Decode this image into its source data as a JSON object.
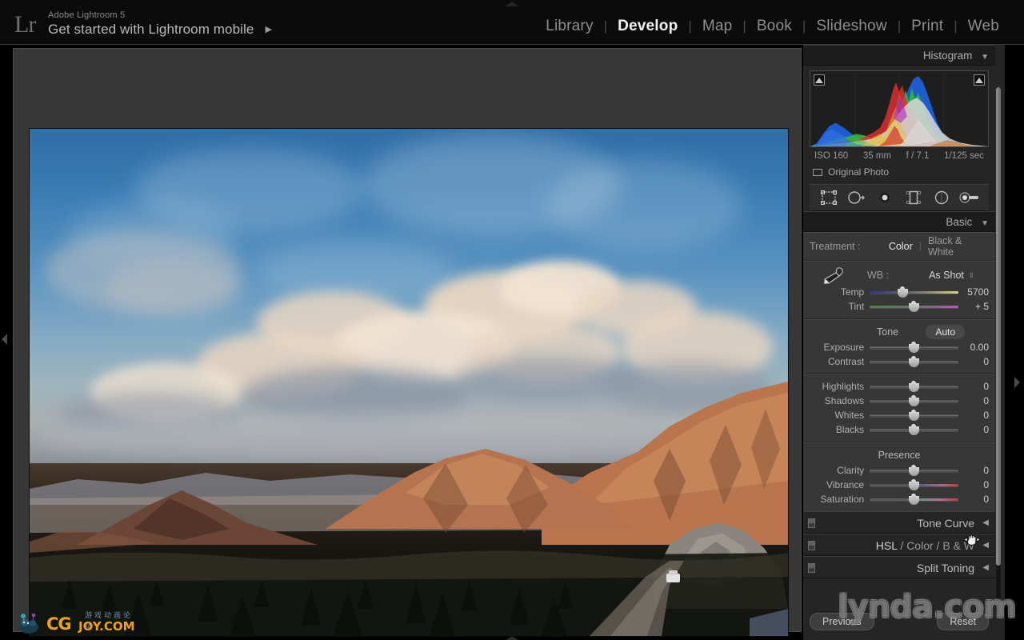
{
  "app": {
    "logo": "Lr",
    "name": "Adobe Lightroom 5",
    "title": "Get started with Lightroom mobile",
    "title_arrow": "▶"
  },
  "modules": [
    {
      "label": "Library",
      "active": false
    },
    {
      "label": "Develop",
      "active": true
    },
    {
      "label": "Map",
      "active": false
    },
    {
      "label": "Book",
      "active": false
    },
    {
      "label": "Slideshow",
      "active": false
    },
    {
      "label": "Print",
      "active": false
    },
    {
      "label": "Web",
      "active": false
    }
  ],
  "module_separator": "|",
  "histogram": {
    "panel_title": "Histogram",
    "collapse_glyph": "▼",
    "shadow_clipping_label": "shadow-clipping",
    "highlight_clipping_label": "highlight-clipping",
    "exif": {
      "iso": "ISO 160",
      "focal_length": "35 mm",
      "aperture": "f / 7.1",
      "shutter": "1/125 sec"
    },
    "source_label": "Original Photo"
  },
  "tools": [
    {
      "name": "crop-overlay-icon",
      "title": "Crop Overlay"
    },
    {
      "name": "spot-removal-icon",
      "title": "Spot Removal"
    },
    {
      "name": "red-eye-correction-icon",
      "title": "Red Eye Correction"
    },
    {
      "name": "graduated-filter-icon",
      "title": "Graduated Filter"
    },
    {
      "name": "radial-filter-icon",
      "title": "Radial Filter"
    },
    {
      "name": "adjustment-brush-icon",
      "title": "Adjustment Brush"
    }
  ],
  "basic": {
    "panel_title": "Basic",
    "collapse_glyph": "▼",
    "treatment": {
      "label": "Treatment :",
      "options": [
        "Color",
        "Black & White"
      ],
      "selected": "Color",
      "separator": "|"
    },
    "wb": {
      "label": "WB :",
      "value": "As Shot",
      "spinner": "⇳",
      "sliders": [
        {
          "name": "Temp",
          "value": "5700",
          "pos": 37
        },
        {
          "name": "Tint",
          "value": "+ 5",
          "pos": 50
        }
      ]
    },
    "tone": {
      "title": "Tone",
      "auto_label": "Auto",
      "sliders": [
        {
          "name": "Exposure",
          "value": "0.00",
          "pos": 50
        },
        {
          "name": "Contrast",
          "value": "0",
          "pos": 50
        }
      ]
    },
    "tone_extra": [
      {
        "name": "Highlights",
        "value": "0",
        "pos": 50
      },
      {
        "name": "Shadows",
        "value": "0",
        "pos": 50
      },
      {
        "name": "Whites",
        "value": "0",
        "pos": 50
      },
      {
        "name": "Blacks",
        "value": "0",
        "pos": 50
      }
    ],
    "presence": {
      "title": "Presence",
      "sliders": [
        {
          "name": "Clarity",
          "value": "0",
          "pos": 50
        },
        {
          "name": "Vibrance",
          "value": "0",
          "pos": 50
        },
        {
          "name": "Saturation",
          "value": "0",
          "pos": 50
        }
      ]
    }
  },
  "collapsed_panels": [
    {
      "title": "Tone Curve",
      "glyph": "◀",
      "parts": null
    },
    {
      "title": "HSL / Color / B & W",
      "glyph": "◀",
      "parts": [
        "HSL",
        "/",
        "Color",
        "/",
        "B & W"
      ]
    },
    {
      "title": "Split Toning",
      "glyph": "◀",
      "parts": null
    }
  ],
  "footer_buttons": {
    "previous": "Previous",
    "reset": "Reset"
  },
  "watermark": {
    "lynda": "lynda.com",
    "cgjoy_cg": "CG",
    "cgjoy_joy": "JOY.COM",
    "cgjoy_cn": "游戏动画论坛"
  },
  "colors": {
    "panel_bg": "#373737",
    "panel_header_bg": "#252525",
    "app_bg": "#000000",
    "text": "#b0b0b0",
    "text_active": "#f2f2f2",
    "stage_bg": "#373737",
    "accent_highlight": "#e6e6e6"
  },
  "photo": {
    "alt": "Desert landscape at sunset with dramatic clouds over Joshua Tree mountains"
  }
}
